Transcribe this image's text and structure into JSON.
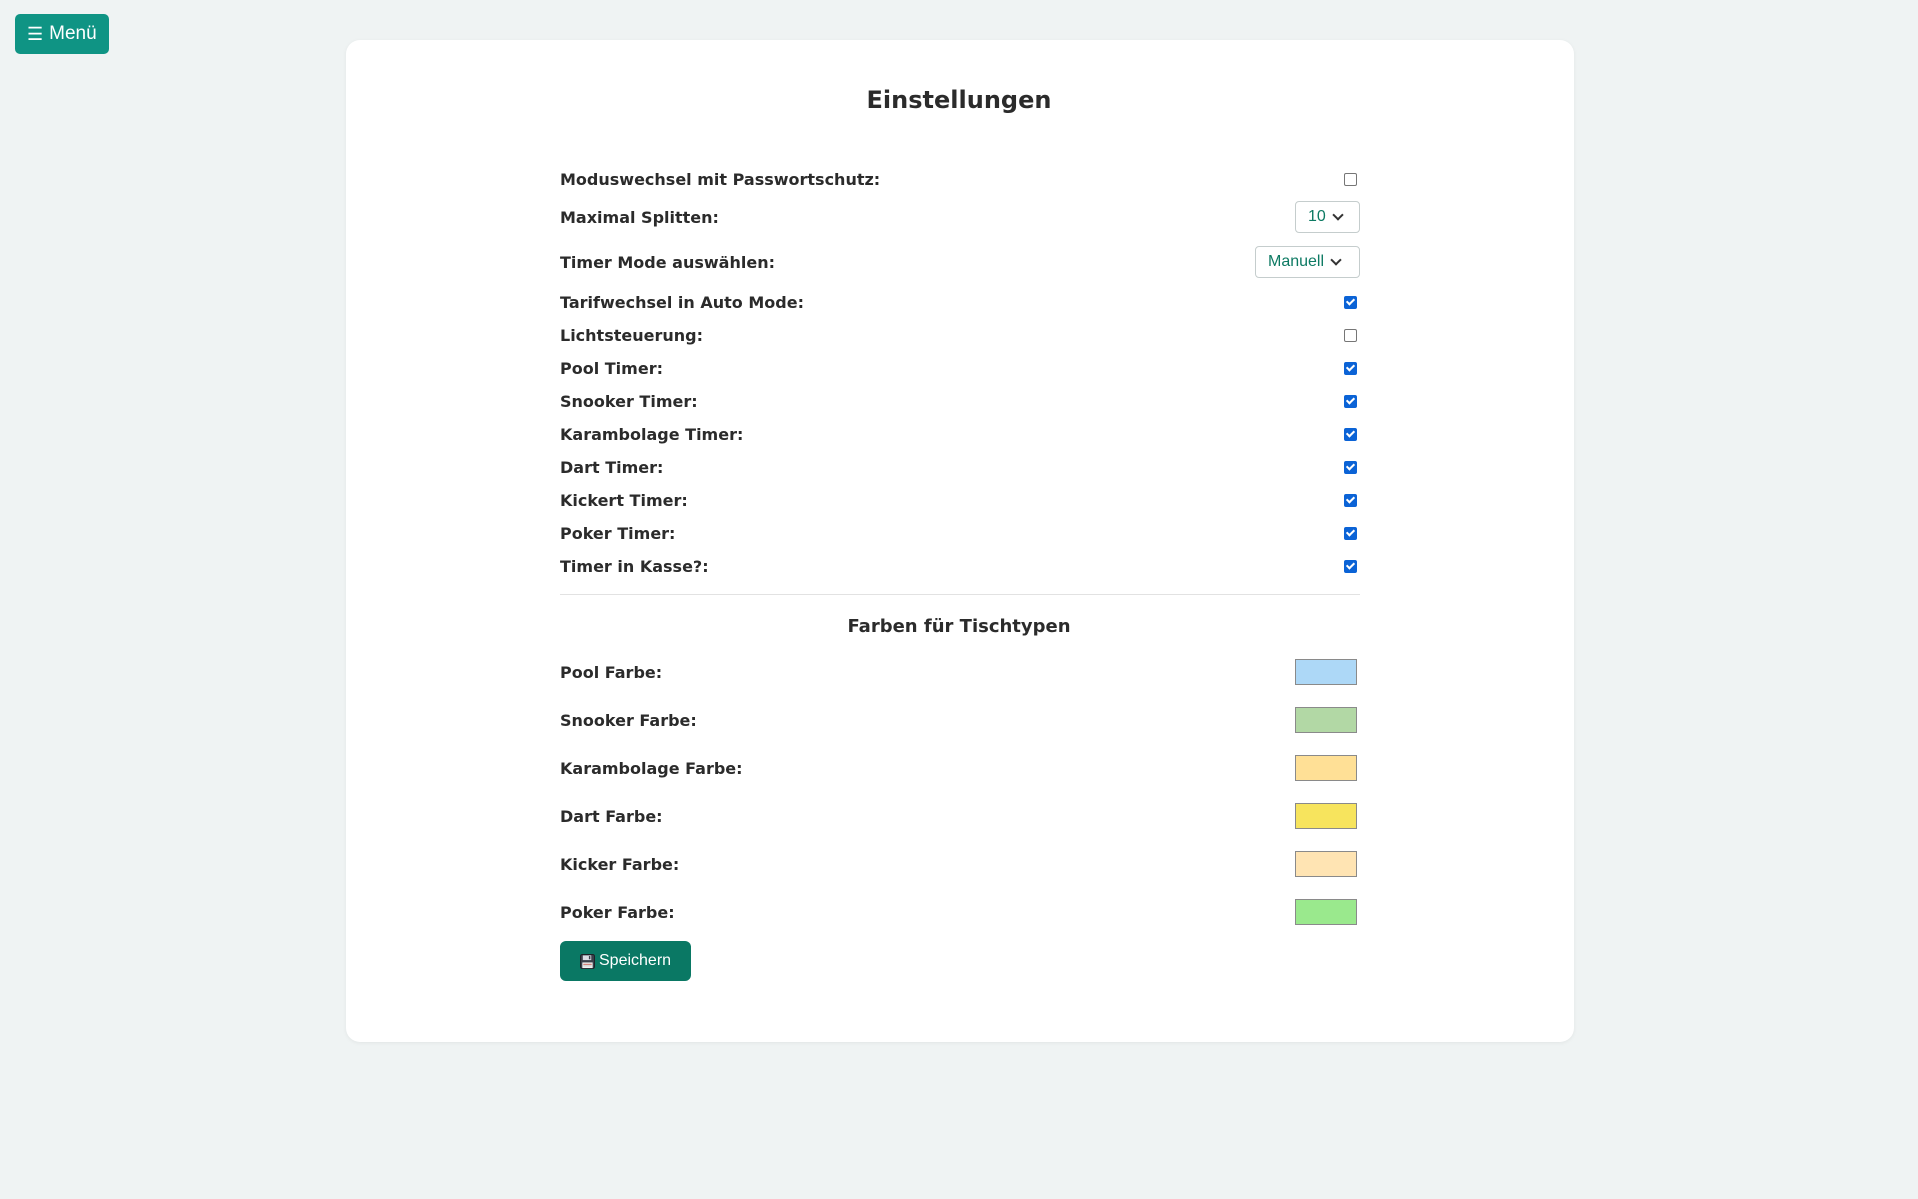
{
  "menu": {
    "icon": "hamburger-icon",
    "label": "Menü"
  },
  "page": {
    "title": "Einstellungen"
  },
  "settings": [
    {
      "label": "Moduswechsel mit Passwortschutz:",
      "type": "checkbox",
      "checked": false
    },
    {
      "label": "Maximal Splitten:",
      "type": "select",
      "value": "10"
    },
    {
      "label": "Timer Mode auswählen:",
      "type": "select",
      "value": "Manuell"
    },
    {
      "label": "Tarifwechsel in Auto Mode:",
      "type": "checkbox",
      "checked": true
    },
    {
      "label": "Lichtsteuerung:",
      "type": "checkbox",
      "checked": false
    },
    {
      "label": "Pool Timer:",
      "type": "checkbox",
      "checked": true
    },
    {
      "label": "Snooker Timer:",
      "type": "checkbox",
      "checked": true
    },
    {
      "label": "Karambolage Timer:",
      "type": "checkbox",
      "checked": true
    },
    {
      "label": "Dart Timer:",
      "type": "checkbox",
      "checked": true
    },
    {
      "label": "Kickert Timer:",
      "type": "checkbox",
      "checked": true
    },
    {
      "label": "Poker Timer:",
      "type": "checkbox",
      "checked": true
    },
    {
      "label": "Timer in Kasse?:",
      "type": "checkbox",
      "checked": true
    }
  ],
  "colors_section": {
    "title": "Farben für Tischtypen",
    "items": [
      {
        "label": "Pool Farbe:",
        "color": "#add8f7"
      },
      {
        "label": "Snooker Farbe:",
        "color": "#b2d8a5"
      },
      {
        "label": "Karambolage Farbe:",
        "color": "#ffe096"
      },
      {
        "label": "Dart Farbe:",
        "color": "#f7e45d"
      },
      {
        "label": "Kicker Farbe:",
        "color": "#ffe4b3"
      },
      {
        "label": "Poker Farbe:",
        "color": "#9ae98d"
      }
    ]
  },
  "save_button": {
    "icon": "floppy-disk-icon",
    "label": "Speichern"
  },
  "theme": {
    "background": "#eff3f3",
    "menu_button": "#0f9484",
    "save_button": "#0a7864",
    "checkbox_checked": "#0b63d6",
    "select_text": "#0d7a63"
  }
}
